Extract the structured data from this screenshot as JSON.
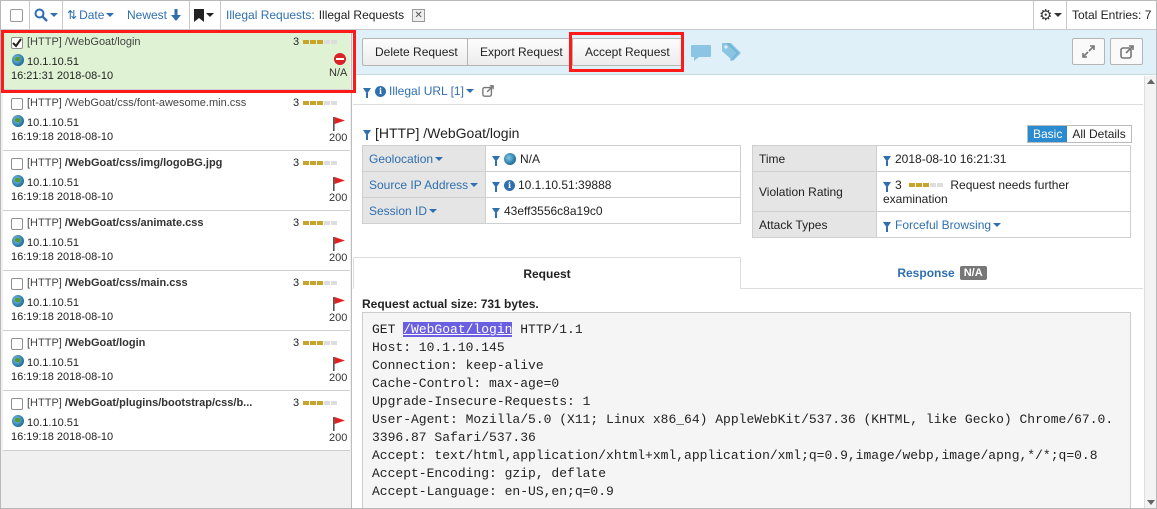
{
  "toolbar": {
    "date_label": "Date",
    "sort_label": "Newest",
    "breadcrumb_link": "Illegal Requests:",
    "breadcrumb_current": "Illegal Requests",
    "total_label": "Total Entries: 7"
  },
  "list": [
    {
      "protocol": "[HTTP]",
      "path": "/WebGoat/login",
      "ip": "10.1.10.51",
      "time": "16:21:31 2018-08-10",
      "score": "3",
      "code": "N/A",
      "selected": true,
      "bold": false
    },
    {
      "protocol": "[HTTP]",
      "path": "/WebGoat/css/font-awesome.min.css",
      "ip": "10.1.10.51",
      "time": "16:19:18 2018-08-10",
      "score": "3",
      "code": "200",
      "selected": false,
      "bold": false
    },
    {
      "protocol": "[HTTP]",
      "path": "/WebGoat/css/img/logoBG.jpg",
      "ip": "10.1.10.51",
      "time": "16:19:18 2018-08-10",
      "score": "3",
      "code": "200",
      "selected": false,
      "bold": true
    },
    {
      "protocol": "[HTTP]",
      "path": "/WebGoat/css/animate.css",
      "ip": "10.1.10.51",
      "time": "16:19:18 2018-08-10",
      "score": "3",
      "code": "200",
      "selected": false,
      "bold": true
    },
    {
      "protocol": "[HTTP]",
      "path": "/WebGoat/css/main.css",
      "ip": "10.1.10.51",
      "time": "16:19:18 2018-08-10",
      "score": "3",
      "code": "200",
      "selected": false,
      "bold": true
    },
    {
      "protocol": "[HTTP]",
      "path": "/WebGoat/login",
      "ip": "10.1.10.51",
      "time": "16:19:18 2018-08-10",
      "score": "3",
      "code": "200",
      "selected": false,
      "bold": true
    },
    {
      "protocol": "[HTTP]",
      "path": "/WebGoat/plugins/bootstrap/css/b...",
      "ip": "10.1.10.51",
      "time": "16:19:18 2018-08-10",
      "score": "3",
      "code": "200",
      "selected": false,
      "bold": true
    }
  ],
  "actions": {
    "delete": "Delete Request",
    "export": "Export Request",
    "accept": "Accept Request"
  },
  "detail": {
    "violation_link": "Illegal URL [1]",
    "title": "[HTTP] /WebGoat/login",
    "view_basic": "Basic",
    "view_all": "All Details",
    "left": [
      {
        "key": "Geolocation",
        "value": "N/A"
      },
      {
        "key": "Source IP Address",
        "value": "10.1.10.51:39888"
      },
      {
        "key": "Session ID",
        "value": "43eff3556c8a19c0"
      }
    ],
    "right": {
      "time_label": "Time",
      "time_value": "2018-08-10 16:21:31",
      "rating_label": "Violation Rating",
      "rating_score": "3",
      "rating_text": "Request needs further examination",
      "attack_label": "Attack Types",
      "attack_value": "Forceful Browsing"
    },
    "tab_request": "Request",
    "tab_response": "Response",
    "response_badge": "N/A",
    "size_label": "Request actual size: 731 bytes.",
    "request_line_pre": "GET ",
    "request_line_url": "/WebGoat/login",
    "request_line_post": " HTTP/1.1",
    "request_body": "Host: 10.1.10.145\nConnection: keep-alive\nCache-Control: max-age=0\nUpgrade-Insecure-Requests: 1\nUser-Agent: Mozilla/5.0 (X11; Linux x86_64) AppleWebKit/537.36 (KHTML, like Gecko) Chrome/67.0.\n3396.87 Safari/537.36\nAccept: text/html,application/xhtml+xml,application/xml;q=0.9,image/webp,image/apng,*/*;q=0.8\nAccept-Encoding: gzip, deflate\nAccept-Language: en-US,en;q=0.9"
  },
  "colors": {
    "accent": "#2f6fb0",
    "selected_row": "#dff3d4",
    "highlight": "#ff1a1a",
    "action_bar": "#dff0f8"
  }
}
